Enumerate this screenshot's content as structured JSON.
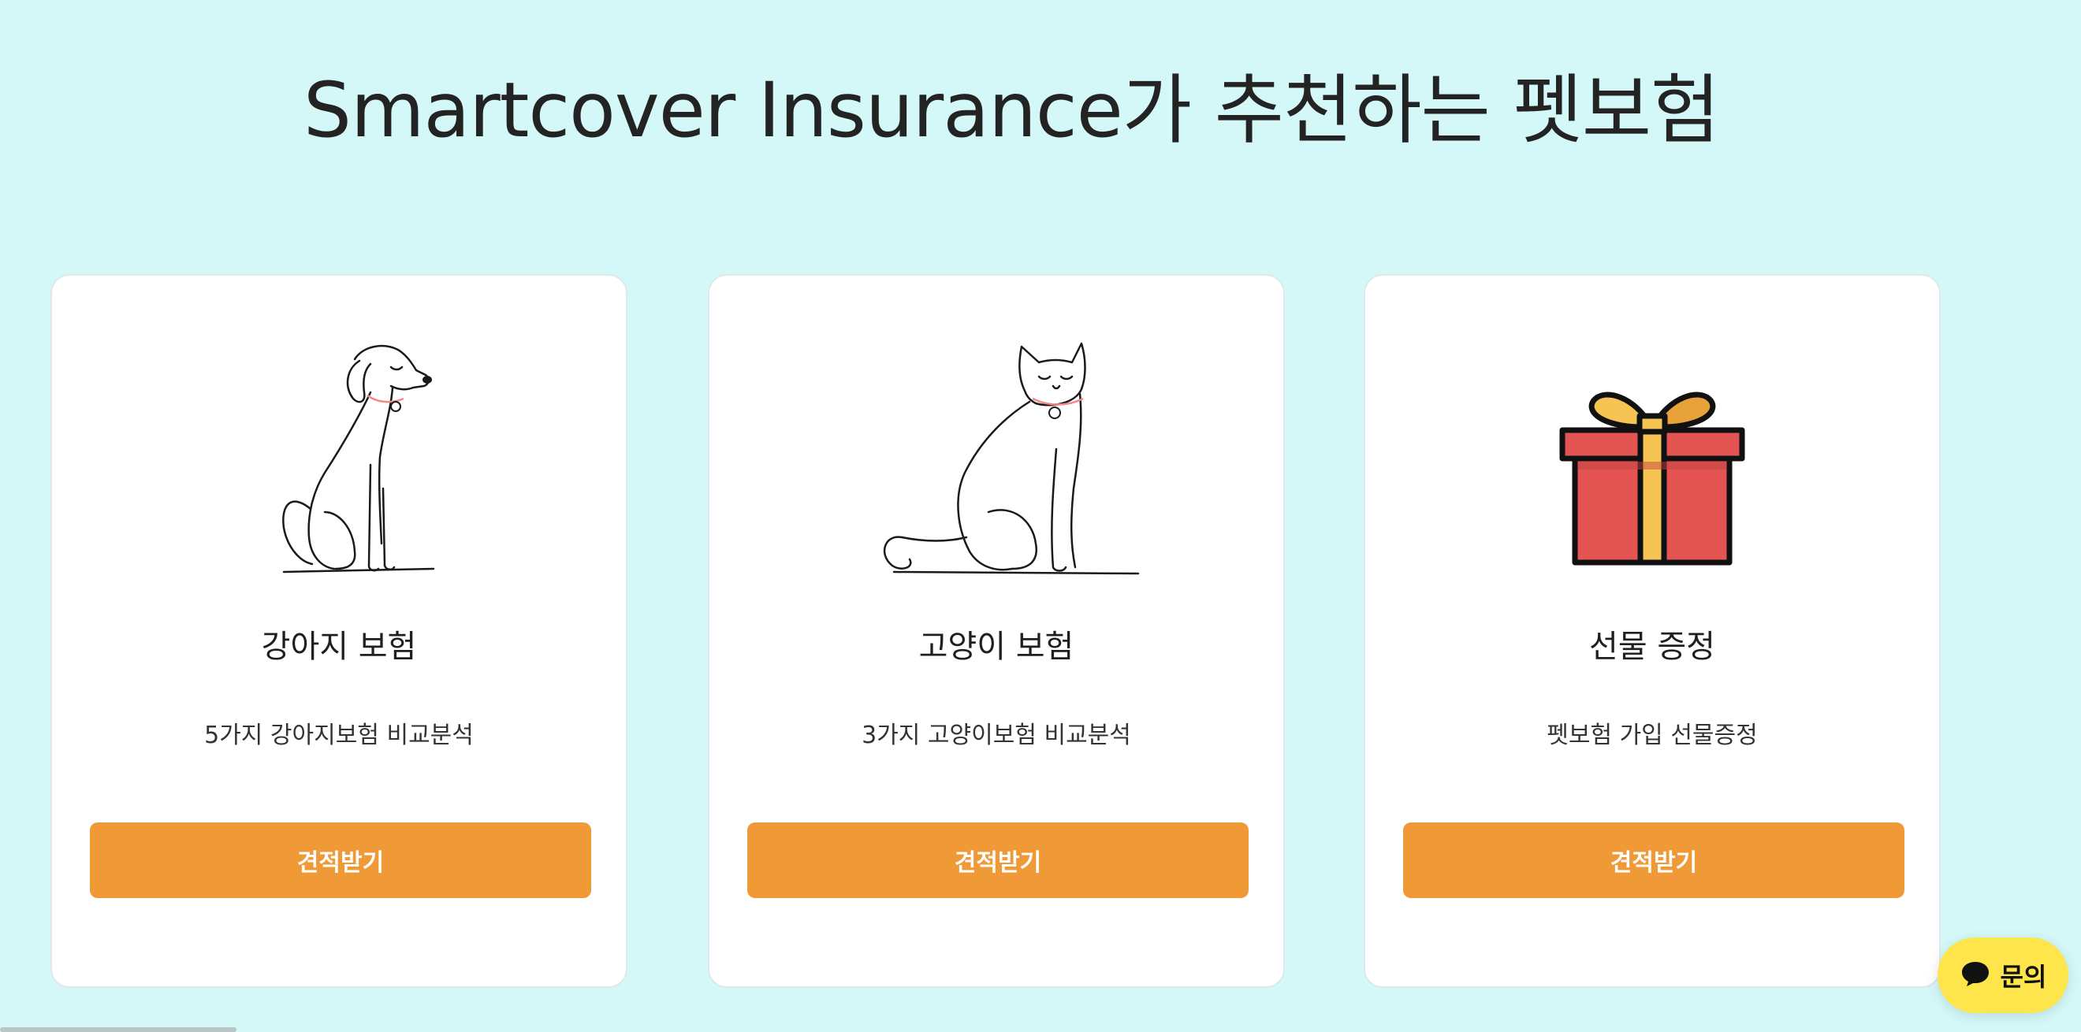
{
  "header": {
    "title": "Smartcover Insurance가 추천하는 펫보험"
  },
  "cards": [
    {
      "icon": "dog-illustration",
      "title": "강아지 보험",
      "description": "5가지 강아지보험 비교분석",
      "button_label": "견적받기"
    },
    {
      "icon": "cat-illustration",
      "title": "고양이 보험",
      "description": "3가지 고양이보험 비교분석",
      "button_label": "견적받기"
    },
    {
      "icon": "gift-icon",
      "title": "선물 증정",
      "description": "펫보험 가입 선물증정",
      "button_label": "견적받기"
    }
  ],
  "chat": {
    "label": "문의",
    "icon": "chat-bubble-icon"
  },
  "colors": {
    "background": "#d4f8f8",
    "button": "#f09a37",
    "chat": "#fde54b",
    "gift_box": "#e35453",
    "gift_ribbon": "#f6c453"
  }
}
